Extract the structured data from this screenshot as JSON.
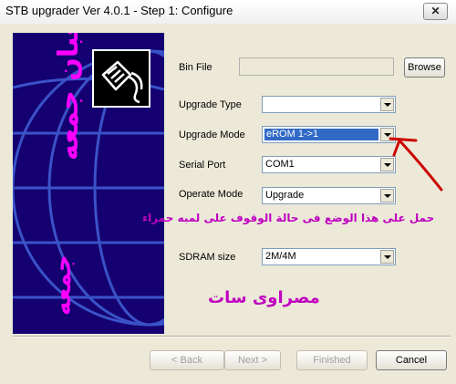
{
  "window": {
    "title": "STB upgrader Ver 4.0.1 - Step 1: Configure",
    "close_icon": "close-icon"
  },
  "side_panel": {
    "logo_icon": "network-cable-icon",
    "vertical_text_1": "شعبان جمعه",
    "vertical_text_2": "جمعه",
    "background_color": "#140070"
  },
  "form": {
    "bin_file": {
      "label": "Bin File",
      "value": "",
      "browse_label": "Browse"
    },
    "upgrade_type": {
      "label": "Upgrade Type",
      "value": ""
    },
    "upgrade_mode": {
      "label": "Upgrade Mode",
      "value": "eROM  1->1"
    },
    "serial_port": {
      "label": "Serial Port",
      "value": "COM1"
    },
    "operate_mode": {
      "label": "Operate Mode",
      "value": "Upgrade"
    },
    "sdram_size": {
      "label": "SDRAM size",
      "value": "2M/4M"
    }
  },
  "annotation": {
    "instruction": "حمل على هذا الوضع فى حالة الوقوف على لمبه حمراء",
    "brand": "مصراوى سات",
    "accent_color": "#c000c0",
    "arrow_color": "#cc0000"
  },
  "buttons": {
    "back": "< Back",
    "next": "Next >",
    "finished": "Finished",
    "cancel": "Cancel"
  }
}
